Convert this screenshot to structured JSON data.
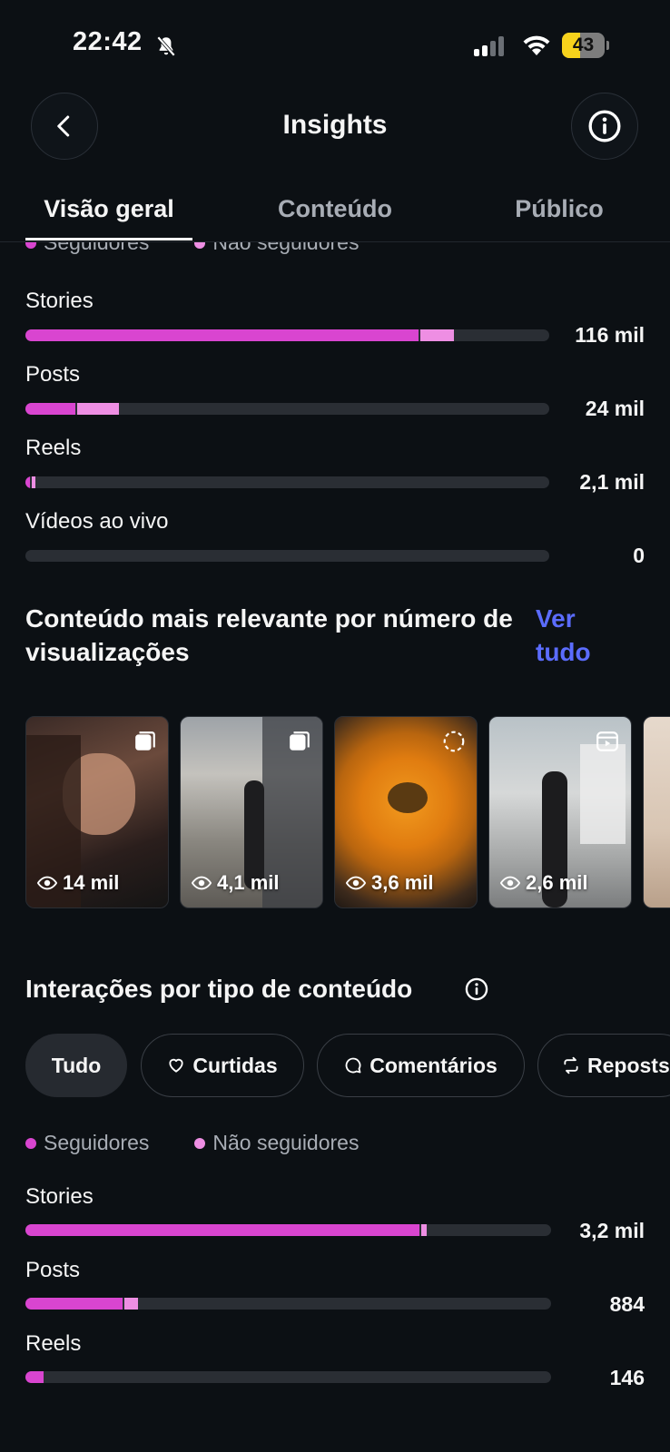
{
  "status_bar": {
    "time": "22:42",
    "battery": "43",
    "battery_level": 0.43
  },
  "header": {
    "title": "Insights"
  },
  "tabs": [
    {
      "label": "Visão geral",
      "active": true
    },
    {
      "label": "Conteúdo",
      "active": false
    },
    {
      "label": "Público",
      "active": false
    }
  ],
  "views_section": {
    "legend": {
      "followers": "Seguidores",
      "non_followers": "Não seguidores"
    },
    "rows": [
      {
        "label": "Stories",
        "value": "116 mil",
        "followers_pct": 75,
        "non_followers_pct": 6.5
      },
      {
        "label": "Posts",
        "value": "24 mil",
        "followers_pct": 9.5,
        "non_followers_pct": 8
      },
      {
        "label": "Reels",
        "value": "2,1 mil",
        "followers_pct": 0.8,
        "non_followers_pct": 0.8
      },
      {
        "label": "Vídeos ao vivo",
        "value": "0",
        "followers_pct": 0,
        "non_followers_pct": 0
      }
    ]
  },
  "top_content": {
    "title": "Conteúdo mais relevante por número de visualizações",
    "see_all": "Ver tudo",
    "items": [
      {
        "views": "14 mil",
        "type_icon": "carousel-icon"
      },
      {
        "views": "4,1 mil",
        "type_icon": "carousel-icon"
      },
      {
        "views": "3,6 mil",
        "type_icon": "story-icon"
      },
      {
        "views": "2,6 mil",
        "type_icon": "reel-icon"
      }
    ]
  },
  "interactions": {
    "title": "Interações por tipo de conteúdo",
    "chips": [
      {
        "label": "Tudo",
        "icon": "",
        "selected": true
      },
      {
        "label": "Curtidas",
        "icon": "heart-icon",
        "selected": false
      },
      {
        "label": "Comentários",
        "icon": "comment-icon",
        "selected": false
      },
      {
        "label": "Reposts",
        "icon": "repost-icon",
        "selected": false
      }
    ],
    "legend": {
      "followers": "Seguidores",
      "non_followers": "Não seguidores"
    },
    "rows": [
      {
        "label": "Stories",
        "value": "3,2 mil",
        "followers_pct": 75,
        "non_followers_pct": 1
      },
      {
        "label": "Posts",
        "value": "884",
        "followers_pct": 18.5,
        "non_followers_pct": 2.5
      },
      {
        "label": "Reels",
        "value": "146",
        "followers_pct": 3.5,
        "non_followers_pct": 0
      }
    ]
  },
  "colors": {
    "followers": "#d945d0",
    "non_followers": "#ee8ee3",
    "link": "#5b6cff",
    "background": "#0c1014"
  }
}
